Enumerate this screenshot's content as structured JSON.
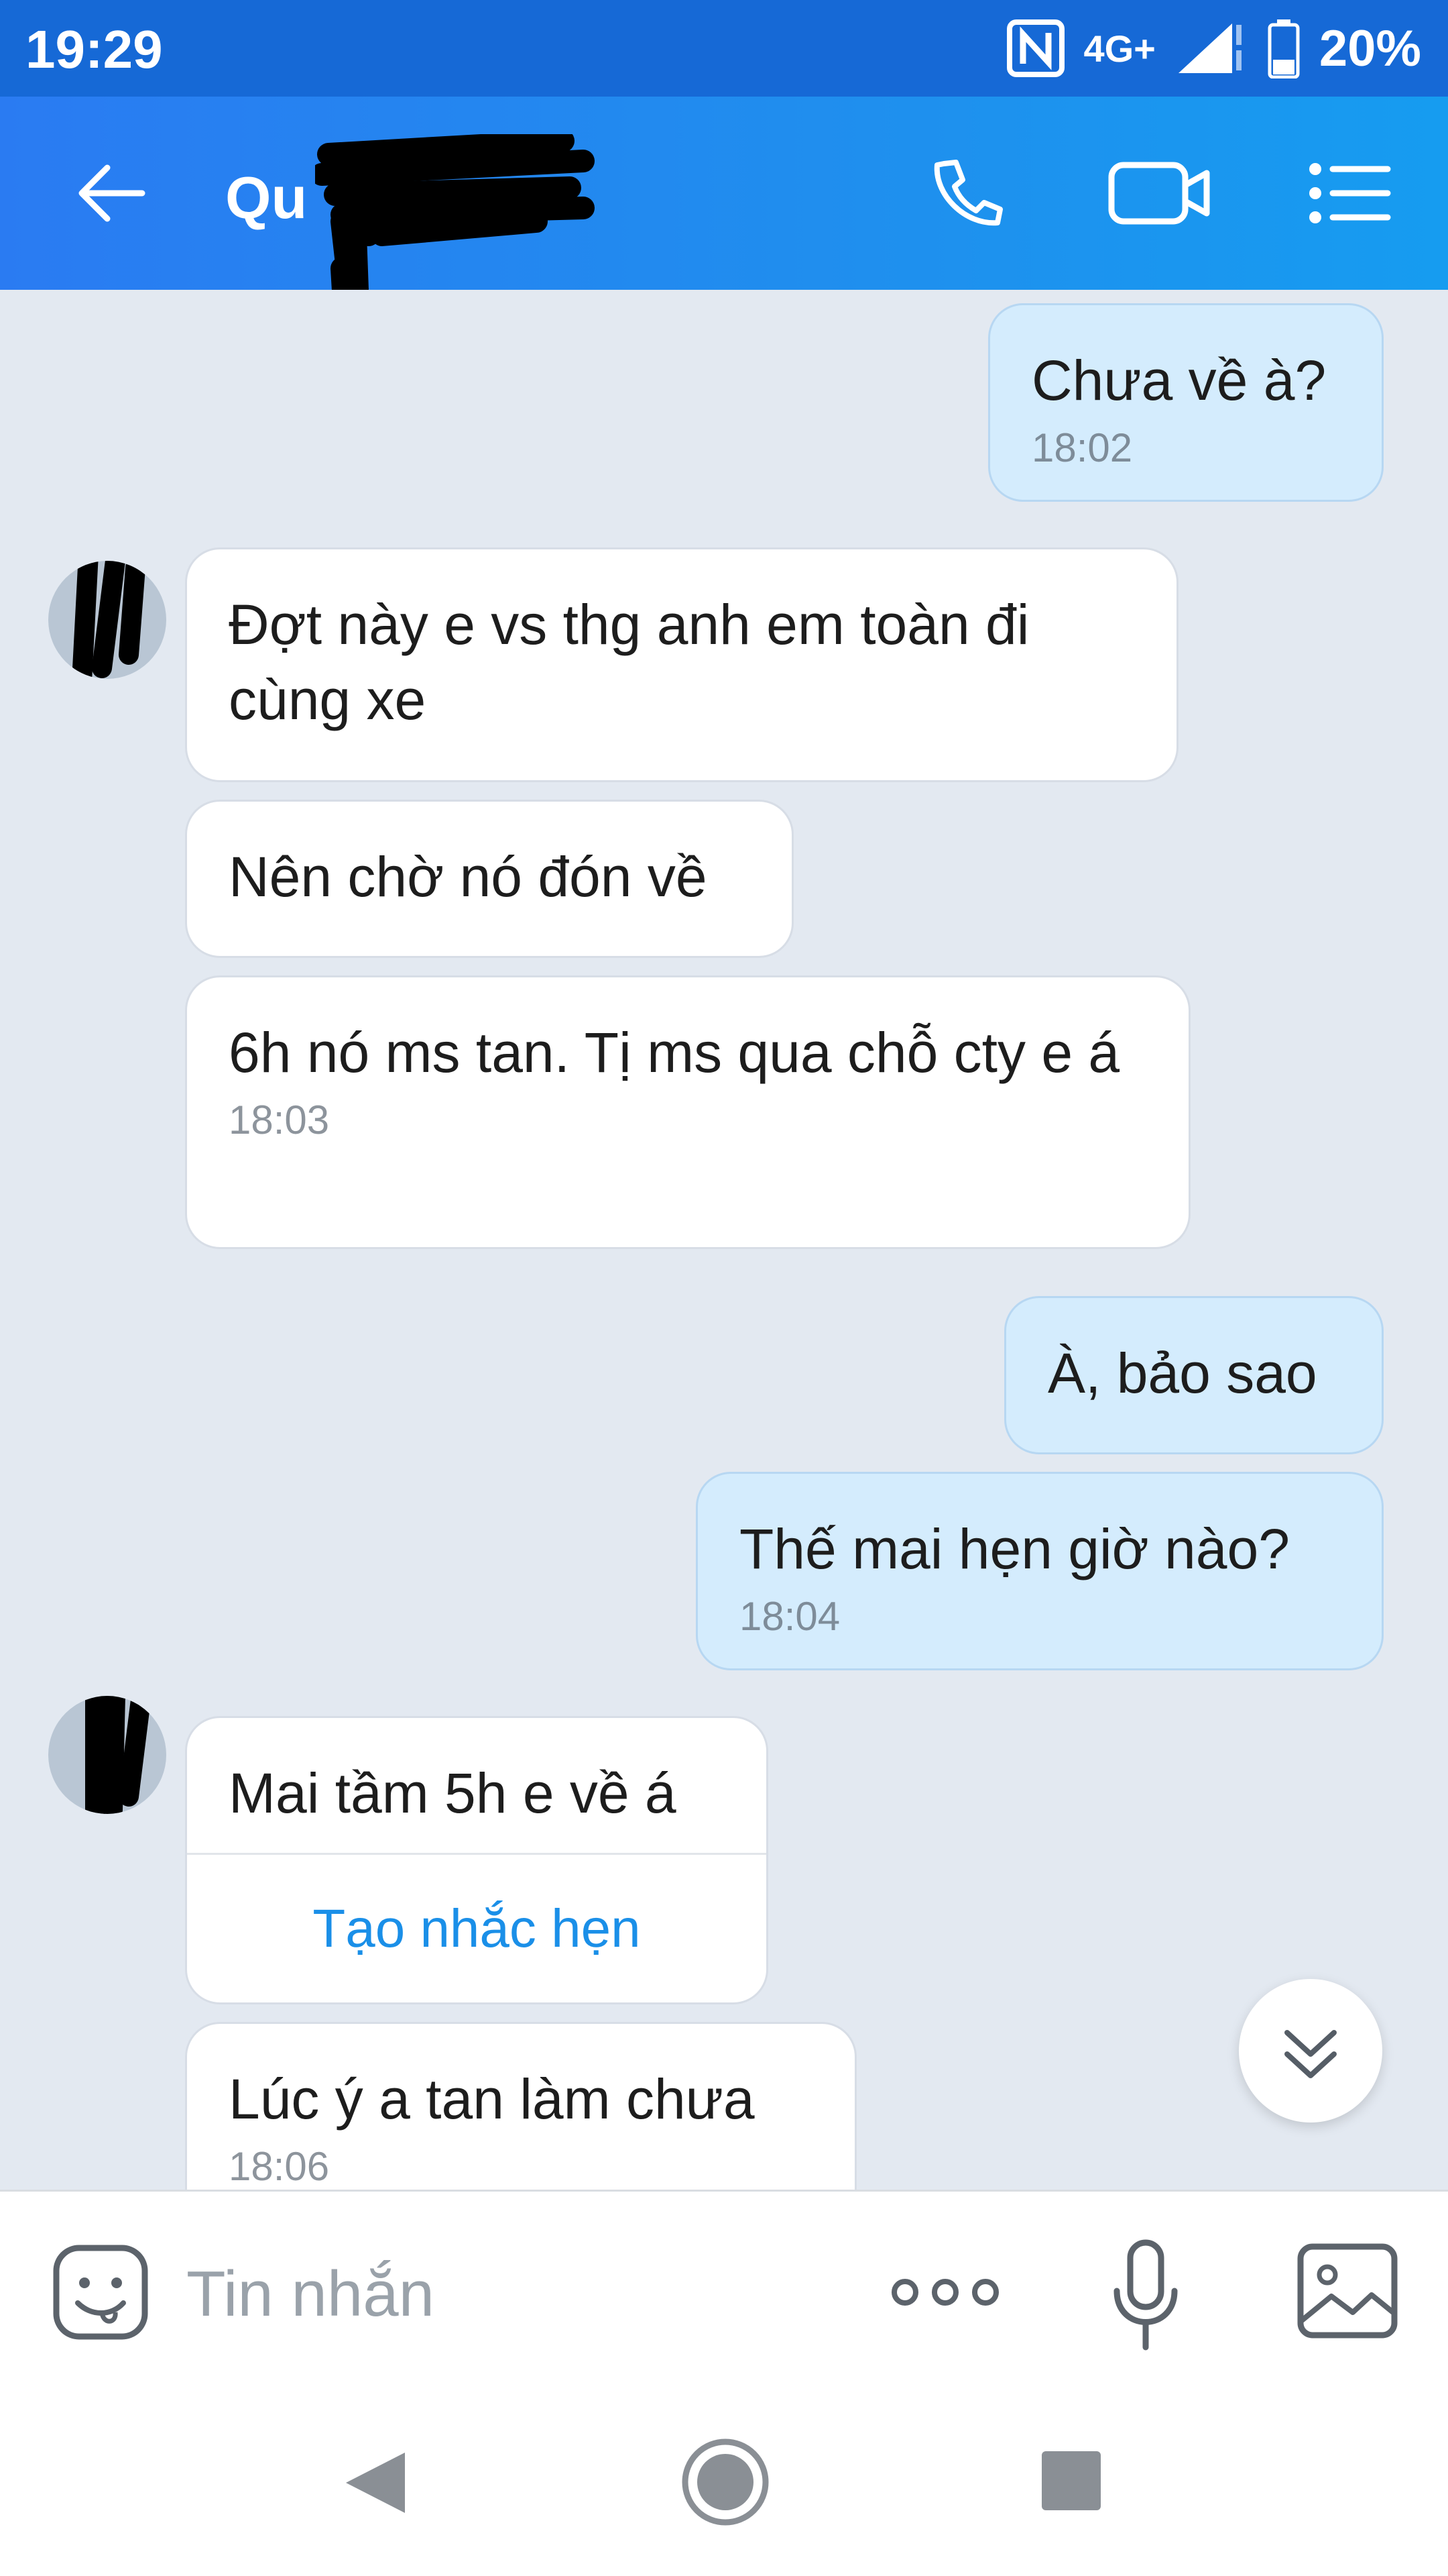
{
  "status_bar": {
    "time": "19:29",
    "network": "4G+",
    "battery": "20%"
  },
  "header": {
    "contact_name_visible": "Qu"
  },
  "messages": [
    {
      "direction": "out",
      "text": "Chưa về à?",
      "time": "18:02"
    },
    {
      "direction": "in",
      "text": "Đợt này e vs thg anh em toàn đi cùng xe"
    },
    {
      "direction": "in",
      "text": "Nên chờ nó đón về"
    },
    {
      "direction": "in",
      "text": "6h nó ms tan. Tị ms qua chỗ cty e á",
      "time": "18:03"
    },
    {
      "direction": "out",
      "text": "À, bảo sao"
    },
    {
      "direction": "out",
      "text": "Thế mai hẹn giờ nào?",
      "time": "18:04"
    },
    {
      "direction": "in",
      "text": "Mai tầm 5h e về á",
      "action": "Tạo nhắc hẹn"
    },
    {
      "direction": "in",
      "text": "Lúc ý a tan làm chưa",
      "time": "18:06"
    }
  ],
  "input": {
    "placeholder": "Tin nhắn"
  },
  "icons": {
    "back": "back-arrow-icon",
    "call": "phone-icon",
    "video": "video-camera-icon",
    "menu": "menu-list-icon",
    "sticker": "sticker-face-icon",
    "more": "more-dots-icon",
    "voice": "microphone-icon",
    "image": "image-icon",
    "scroll_down": "chevron-double-down-icon"
  },
  "colors": {
    "header": "#2a7bf2",
    "status_bar": "#1669d6",
    "outgoing_bubble": "#d4ecfd",
    "incoming_bubble": "#ffffff",
    "link": "#1a8fe8",
    "chat_background": "#e3e9f1"
  }
}
